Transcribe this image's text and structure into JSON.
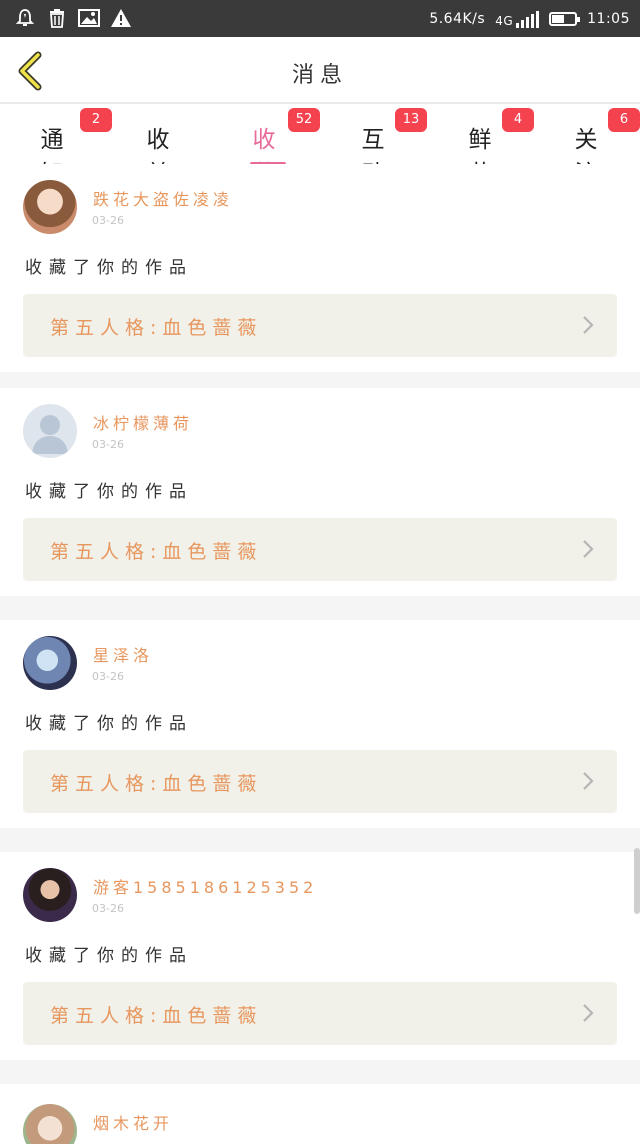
{
  "status_bar": {
    "net_speed": "5.64K/s",
    "network": "4G",
    "time": "11:05",
    "battery_level": 0.55
  },
  "header": {
    "title": "消息"
  },
  "tabs": [
    {
      "label": "通知",
      "badge": "2"
    },
    {
      "label": "收益",
      "badge": ""
    },
    {
      "label": "收藏",
      "badge": "52",
      "active": true
    },
    {
      "label": "互动",
      "badge": "13"
    },
    {
      "label": "鲜花",
      "badge": "4"
    },
    {
      "label": "关注",
      "badge": "6"
    }
  ],
  "messages": [
    {
      "username": "跌花大盗佐凌凌",
      "date": "03-26",
      "action": "收藏了你的作品",
      "work": "第五人格:血色蔷薇",
      "avatar": "avatar-anime-girl-brown"
    },
    {
      "username": "冰柠檬薄荷",
      "date": "03-26",
      "action": "收藏了你的作品",
      "work": "第五人格:血色蔷薇",
      "avatar": "avatar-default-user"
    },
    {
      "username": "星泽洛",
      "date": "03-26",
      "action": "收藏了你的作品",
      "work": "第五人格:血色蔷薇",
      "avatar": "avatar-anime-blue"
    },
    {
      "username": "游客1585186125352",
      "date": "03-26",
      "action": "收藏了你的作品",
      "work": "第五人格:血色蔷薇",
      "avatar": "avatar-photo-woman"
    },
    {
      "username": "烟木花开",
      "date": "",
      "action": "",
      "work": "",
      "avatar": "avatar-anime-girl-light"
    }
  ],
  "colors": {
    "accent": "#e86a9a",
    "badge": "#f4424f",
    "name": "#e7975e",
    "work_bg": "#f2f1e9"
  }
}
